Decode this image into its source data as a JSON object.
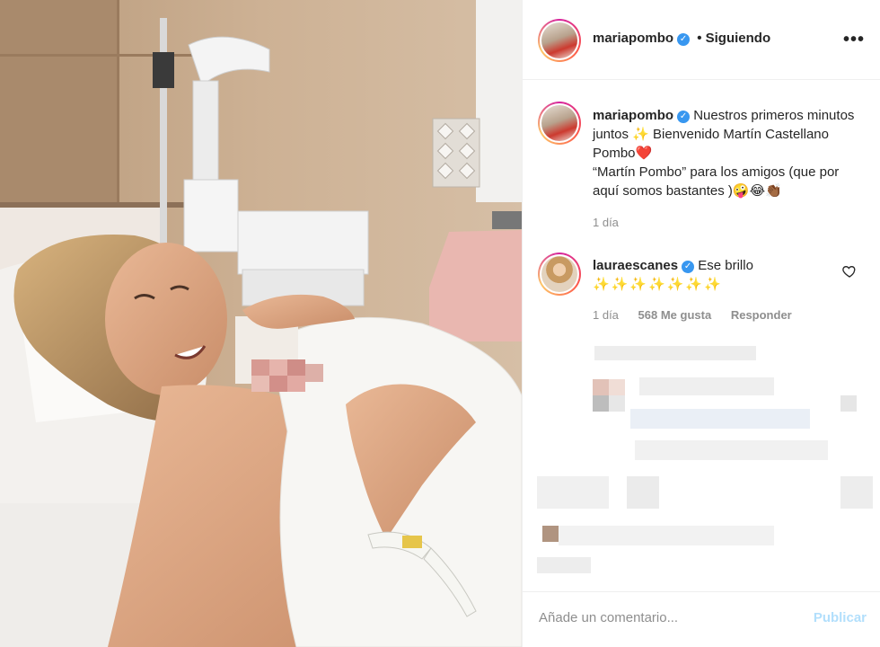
{
  "post": {
    "author": "mariapombo",
    "follow_status": "• Siguiendo",
    "more_icon": "more-dots-icon"
  },
  "caption": {
    "author": "mariapombo",
    "line1": "Nuestros primeros minutos juntos ✨ Bienvenido Martín Castellano Pombo❤️",
    "line2": "“Martín Pombo” para los amigos (que por aquí somos bastantes )🤪😂👏🏾",
    "time": "1 día"
  },
  "comments": [
    {
      "author": "lauraescanes",
      "text": "Ese brillo",
      "emoji": "✨✨✨✨✨✨✨",
      "time": "1 día",
      "likes": "568 Me gusta",
      "reply": "Responder"
    }
  ],
  "composer": {
    "placeholder": "Añade un comentario...",
    "publish": "Publicar"
  },
  "colors": {
    "verified": "#3897f0",
    "publish_disabled": "#b2dffc",
    "meta_text": "#8e8e8e"
  }
}
